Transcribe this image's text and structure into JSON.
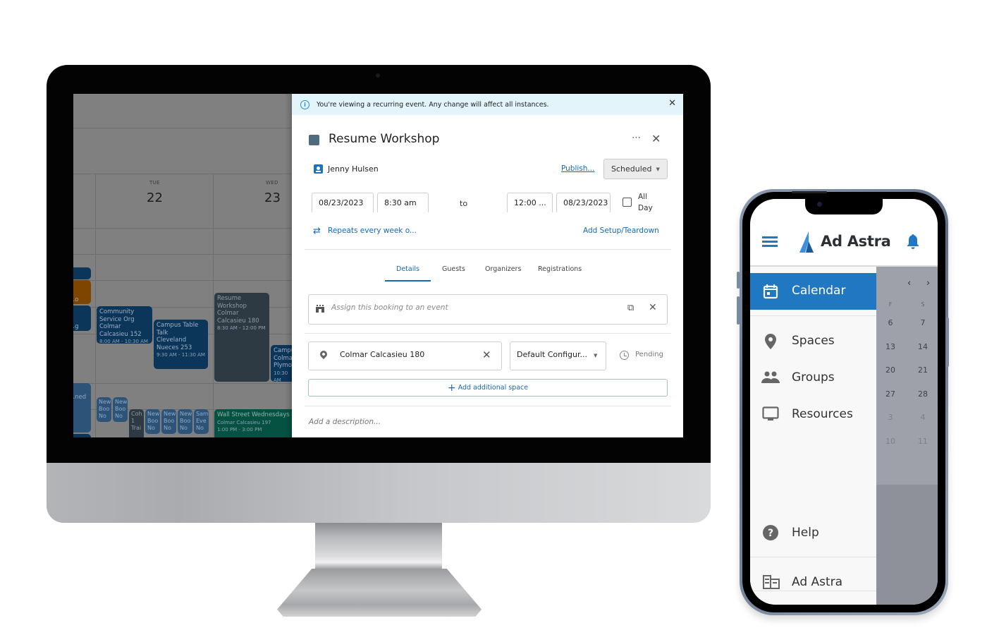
{
  "desktop": {
    "calendar": {
      "days": [
        {
          "name": "TUE",
          "num": "22"
        },
        {
          "name": "WED",
          "num": "23"
        }
      ],
      "events": [
        {
          "title": "Community Service Org",
          "location": "Colmar Calcasieu 152",
          "time": "8:00 AM - 10:30 AM"
        },
        {
          "title": "Campus Table Talk",
          "location": "Cleveland Nueces 253",
          "time": "9:30 AM - 11:30 AM"
        },
        {
          "title": "Resume Workshop",
          "location": "Colmar Calcasieu 180",
          "time": "8:30 AM - 12:00 PM"
        },
        {
          "title": "Campus",
          "location": "Colmar Plymouth",
          "time": "10:30 AM"
        },
        {
          "title": "Wall Street Wednesdays",
          "location": "Colmar Calcasieu 197",
          "time": "1:00 PM - 3:00 PM"
        },
        {
          "title": "...ned",
          "location": "",
          "time": ""
        },
        {
          "title": "...g",
          "location": "",
          "time": ""
        },
        {
          "title": "...o",
          "location": "",
          "time": ""
        }
      ],
      "small_events": [
        {
          "l1": "New",
          "l2": "Boo",
          "l3": "No"
        },
        {
          "l1": "New",
          "l2": "Boo",
          "l3": "No"
        },
        {
          "l1": "Coh",
          "l2": "1",
          "l3": "Trai"
        },
        {
          "l1": "New",
          "l2": "Boo",
          "l3": "No"
        },
        {
          "l1": "New",
          "l2": "Boo",
          "l3": "No"
        },
        {
          "l1": "New",
          "l2": "Boo",
          "l3": "No"
        },
        {
          "l1": "Sam",
          "l2": "Eve",
          "l3": "No"
        }
      ]
    },
    "panel": {
      "banner": "You're viewing a recurring event. Any change will affect all instances.",
      "title": "Resume Workshop",
      "swatch_color": "#4f6b7e",
      "more_label": "⋯",
      "close_label": "✕",
      "owner": "Jenny Hulsen",
      "publish": "Publish...",
      "status": "Scheduled",
      "start_date": "08/23/2023",
      "start_time": "8:30 am",
      "to_label": "to",
      "end_time": "12:00 ...",
      "end_date": "08/23/2023",
      "all_day_label_1": "All",
      "all_day_label_2": "Day",
      "all_day_checked": false,
      "repeat": "Repeats every week o...",
      "setup_teardown": "Add Setup/Teardown",
      "tabs": [
        {
          "label": "Details",
          "active": true
        },
        {
          "label": "Guests",
          "active": false
        },
        {
          "label": "Organizers",
          "active": false
        },
        {
          "label": "Registrations",
          "active": false
        }
      ],
      "assign_placeholder": "Assign this booking to an event",
      "space": "Colmar Calcasieu 180",
      "configuration": "Default Configur...",
      "space_status": "Pending",
      "add_space": "Add additional space",
      "description_placeholder": "Add a description...",
      "accent": "#1668b2"
    }
  },
  "mobile": {
    "brand": "Ad Astra",
    "nav": [
      {
        "label": "Calendar",
        "icon": "calendar-icon",
        "active": true
      },
      {
        "label": "Spaces",
        "icon": "location-pin-icon",
        "active": false
      },
      {
        "label": "Groups",
        "icon": "groups-icon",
        "active": false
      },
      {
        "label": "Resources",
        "icon": "monitor-icon",
        "active": false
      },
      {
        "label": "Help",
        "icon": "help-icon",
        "active": false
      },
      {
        "label": "Ad Astra",
        "icon": "building-icon",
        "active": false
      }
    ],
    "minical": {
      "headers": [
        "F",
        "S"
      ],
      "rows": [
        [
          "6",
          "7"
        ],
        [
          "13",
          "14"
        ],
        [
          "20",
          "21"
        ],
        [
          "27",
          "28"
        ],
        [
          "3",
          "4"
        ],
        [
          "10",
          "11"
        ]
      ],
      "dim_rows": [
        4,
        5
      ],
      "prev": "‹",
      "next": "›"
    },
    "accent": "#1f78c1"
  }
}
